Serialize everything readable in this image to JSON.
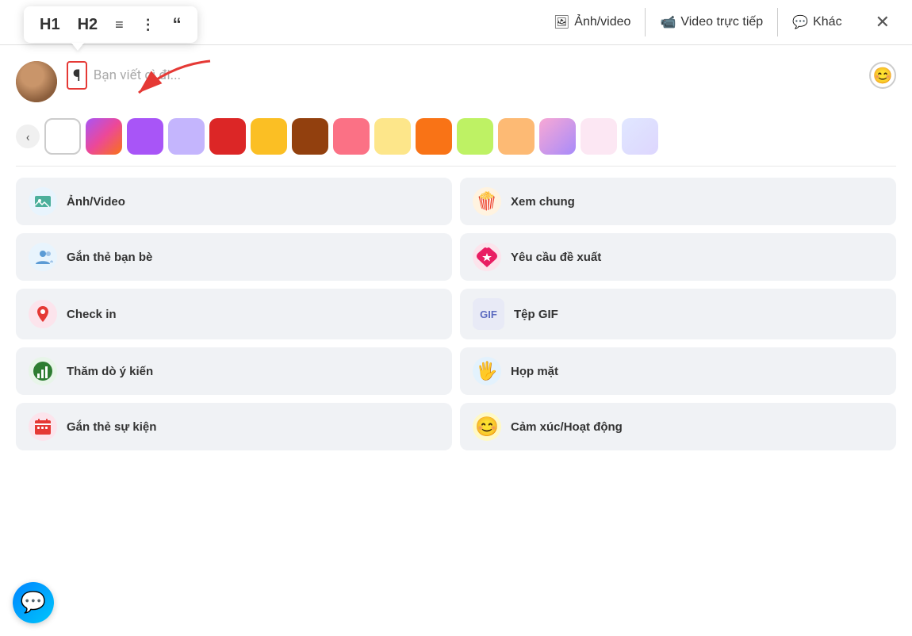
{
  "toolbar": {
    "format_buttons": [
      {
        "label": "H1",
        "id": "h1"
      },
      {
        "label": "H2",
        "id": "h2"
      },
      {
        "label": "≡•",
        "id": "ul"
      },
      {
        "label": "•≡",
        "id": "ol"
      },
      {
        "label": "““",
        "id": "quote"
      }
    ],
    "tabs": [
      {
        "icon": "🖼",
        "label": "Ảnh/video",
        "id": "photo"
      },
      {
        "icon": "📹",
        "label": "Video trực tiếp",
        "id": "live"
      },
      {
        "icon": "💬",
        "label": "Khác",
        "id": "other"
      }
    ],
    "close_label": "✕"
  },
  "post_input": {
    "placeholder": "Bạn viết gì đi...",
    "emoji_icon": "😊"
  },
  "bg_swatches": [
    {
      "color": "#ffffff",
      "id": "white"
    },
    {
      "color": "linear-gradient(135deg, #a855f7, #ec4899, #f97316)",
      "id": "gradient1"
    },
    {
      "color": "#a855f7",
      "id": "purple"
    },
    {
      "color": "#c4b5fd",
      "id": "lavender"
    },
    {
      "color": "#dc2626",
      "id": "red"
    },
    {
      "color": "#fbbf24",
      "id": "yellow"
    },
    {
      "color": "#92400e",
      "id": "brown"
    },
    {
      "color": "#fb7185",
      "id": "pink"
    },
    {
      "color": "#fde68a",
      "id": "lightyellow"
    },
    {
      "color": "#f97316",
      "id": "orange"
    },
    {
      "color": "#bef264",
      "id": "lime"
    },
    {
      "color": "#fdba74",
      "id": "peach"
    },
    {
      "color": "linear-gradient(135deg, #f9a8d4, #a78bfa)",
      "id": "gradient2"
    },
    {
      "color": "#fce7f3",
      "id": "lightpink"
    },
    {
      "color": "linear-gradient(135deg, #e0e7ff, #ddd6fe)",
      "id": "gradient3"
    }
  ],
  "actions": [
    {
      "icon_bg": "#e8f4fd",
      "icon": "🖼",
      "label": "Ảnh/Video",
      "id": "photo"
    },
    {
      "icon_bg": "#fff3e0",
      "icon": "🍿",
      "label": "Xem chung",
      "id": "watch"
    },
    {
      "icon_bg": "#e8f4fd",
      "icon": "👤",
      "label": "Gắn thẻ bạn bè",
      "id": "tag"
    },
    {
      "icon_bg": "#fce4ec",
      "icon": "⭐",
      "label": "Yêu cầu đề xuất",
      "id": "recommend"
    },
    {
      "icon_bg": "#fce4ec",
      "icon": "📍",
      "label": "Check in",
      "id": "checkin"
    },
    {
      "icon_bg": "#e8eaf6",
      "icon": "GIF",
      "label": "Tệp GIF",
      "id": "gif"
    },
    {
      "icon_bg": "#e8f5e9",
      "icon": "📊",
      "label": "Thăm dò ý kiến",
      "id": "poll"
    },
    {
      "icon_bg": "#e3f2fd",
      "icon": "🖐",
      "label": "Họp mặt",
      "id": "meeting"
    },
    {
      "icon_bg": "#fce4ec",
      "icon": "📅",
      "label": "Gắn thẻ sự kiện",
      "id": "event"
    },
    {
      "icon_bg": "#fff9c4",
      "icon": "😊",
      "label": "Cảm xúc/Hoạt động",
      "id": "feeling"
    }
  ],
  "messenger": {
    "icon": "💬"
  }
}
